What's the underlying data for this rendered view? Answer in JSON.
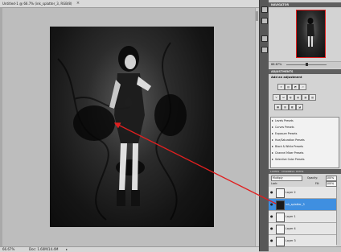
{
  "document": {
    "title": "Untitled-1 @ 66.7% (ink_splatter_3, RGB/8)",
    "close_glyph": "×",
    "zoom": "66.67%",
    "doc_size": "Doc: 1.60M/14.4M",
    "status_arrow": "▸"
  },
  "navigator": {
    "tab": "NAVIGATOR",
    "zoom": "66.67%"
  },
  "adjustments": {
    "tab": "ADJUSTMENTS",
    "hint": "Add an adjustment",
    "icons": [
      "☀",
      "▥",
      "◩",
      "▱",
      "V",
      "⊟",
      "◐",
      "▤",
      "◨",
      "▨",
      "▦",
      "▧",
      "◧",
      "◪"
    ],
    "presets": [
      "Levels Presets",
      "Curves Presets",
      "Exposure Presets",
      "Hue/Saturation Presets",
      "Black & White Presets",
      "Channel Mixer Presets",
      "Selective Color Presets"
    ]
  },
  "layers": {
    "tabs": [
      "LAYERS",
      "CHANNELS",
      "PATHS"
    ],
    "blend_mode": "Multiply",
    "opacity_label": "Opacity:",
    "opacity": "100%",
    "lock_label": "Lock:",
    "fill_label": "Fill:",
    "fill": "100%",
    "eye_glyph": "●",
    "items": [
      {
        "name": "Layer 2",
        "selected": false
      },
      {
        "name": "ink_splatter_3",
        "selected": true
      },
      {
        "name": "Layer 1",
        "selected": false
      },
      {
        "name": "Layer 4",
        "selected": false
      },
      {
        "name": "Layer 3",
        "selected": false
      }
    ]
  },
  "colors": {
    "selected_layer": "#3f8fe0",
    "annotation_arrow": "#e01f1f"
  }
}
